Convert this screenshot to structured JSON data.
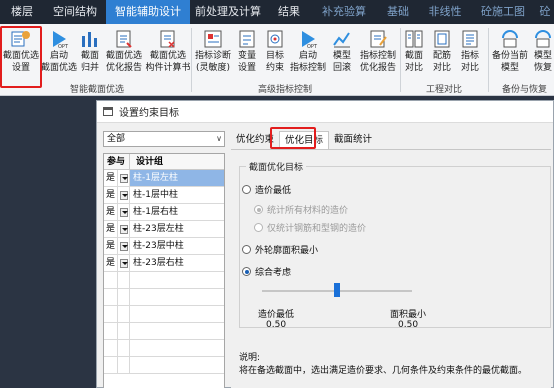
{
  "tabs": [
    {
      "label": "楼层",
      "style": "normal"
    },
    {
      "label": "空间结构",
      "style": "normal"
    },
    {
      "label": "智能辅助设计",
      "style": "active"
    },
    {
      "label": "前处理及计算",
      "style": "normal"
    },
    {
      "label": "结果",
      "style": "normal"
    },
    {
      "label": "补充验算",
      "style": "dim"
    },
    {
      "label": "基础",
      "style": "dim"
    },
    {
      "label": "非线性",
      "style": "dim"
    },
    {
      "label": "砼施工图",
      "style": "dim"
    },
    {
      "label": "砼",
      "style": "dim"
    }
  ],
  "ribbon": {
    "buttons": [
      {
        "line1": "截面优选",
        "line2": "设置",
        "icon": "section-settings-icon"
      },
      {
        "line1": "启动",
        "line2": "截面优选",
        "icon": "start-opt-icon"
      },
      {
        "line1": "截面",
        "line2": "归并",
        "icon": "section-merge-icon"
      },
      {
        "line1": "截面优选",
        "line2": "优化报告",
        "icon": "report-icon"
      },
      {
        "line1": "截面优选",
        "line2": "构件计算书",
        "icon": "calc-book-icon"
      },
      {
        "line1": "指标诊断",
        "line2": "(灵敏度)",
        "icon": "diagnosis-icon"
      },
      {
        "line1": "变量",
        "line2": "设置",
        "icon": "variable-icon"
      },
      {
        "line1": "目标",
        "line2": "约束",
        "icon": "target-icon"
      },
      {
        "line1": "启动",
        "line2": "指标控制",
        "icon": "start-control-icon"
      },
      {
        "line1": "模型",
        "line2": "回滚",
        "icon": "rollback-icon"
      },
      {
        "line1": "指标控制",
        "line2": "优化报告",
        "icon": "control-report-icon"
      },
      {
        "line1": "截面",
        "line2": "对比",
        "icon": "section-compare-icon"
      },
      {
        "line1": "配筋",
        "line2": "对比",
        "icon": "rebar-compare-icon"
      },
      {
        "line1": "指标",
        "line2": "对比",
        "icon": "index-compare-icon"
      },
      {
        "line1": "备份当前",
        "line2": "模型",
        "icon": "backup-icon"
      },
      {
        "line1": "模型",
        "line2": "恢复",
        "icon": "restore-icon"
      }
    ],
    "groups": [
      "智能截面优选",
      "高级指标控制",
      "工程对比",
      "备份与恢复"
    ]
  },
  "dialog": {
    "title": "设置约束目标",
    "filter": "全部",
    "grid": {
      "headers": [
        "参与",
        "设计组"
      ],
      "rows": [
        {
          "flag": "是",
          "name": "柱-1层左柱",
          "selected": true
        },
        {
          "flag": "是",
          "name": "柱-1层中柱",
          "selected": false
        },
        {
          "flag": "是",
          "name": "柱-1层右柱",
          "selected": false
        },
        {
          "flag": "是",
          "name": "柱-23层左柱",
          "selected": false
        },
        {
          "flag": "是",
          "name": "柱-23层中柱",
          "selected": false
        },
        {
          "flag": "是",
          "name": "柱-23层右柱",
          "selected": false
        }
      ]
    },
    "tabs": [
      "优化约束",
      "优化目标",
      "截面统计"
    ],
    "active_tab": "优化目标",
    "group_title": "截面优化目标",
    "opt_cost": "造价最低",
    "opt_cost_all": "统计所有材料的造价",
    "opt_cost_steel": "仅统计钢筋和型钢的造价",
    "opt_area": "外轮廓面积最小",
    "opt_combined": "综合考虑",
    "slider_left_label": "造价最低",
    "slider_right_label": "面积最小",
    "slider_left_value": "0.50",
    "slider_right_value": "0.50",
    "slider_fraction": 0.5,
    "note_title": "说明:",
    "note_text": "将在备选截面中，选出满足造价要求、几何条件及约束条件的最优截面。"
  },
  "colors": {
    "accent": "#2f7fd2",
    "highlight": "#e21d1d",
    "selected_row": "#8fb6e6"
  }
}
